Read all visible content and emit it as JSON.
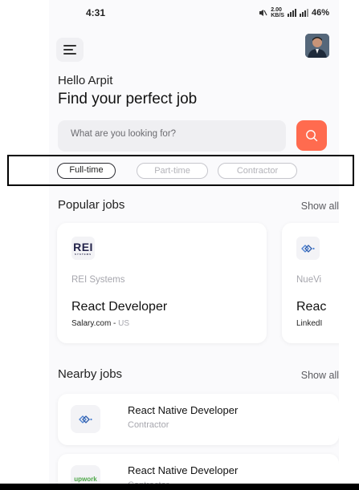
{
  "status_bar": {
    "time": "4:31",
    "net_speed_top": "2.00",
    "net_speed_bottom": "KB/S",
    "battery": "46%"
  },
  "header": {
    "greeting": "Hello Arpit",
    "headline": "Find your perfect job"
  },
  "search": {
    "placeholder": "What are you looking for?"
  },
  "filters": [
    {
      "label": "Full-time",
      "active": true
    },
    {
      "label": "Part-time",
      "active": false
    },
    {
      "label": "Contractor",
      "active": false
    }
  ],
  "popular": {
    "title": "Popular jobs",
    "show_all": "Show all",
    "cards": [
      {
        "company": "REI Systems",
        "title": "React Developer",
        "source": "Salary.com",
        "location": "US",
        "logo_text": "REI",
        "logo_sub": "SYSTEMS"
      },
      {
        "company": "NueVi",
        "title": "Reac",
        "source": "LinkedI",
        "location": ""
      }
    ]
  },
  "nearby": {
    "title": "Nearby jobs",
    "show_all": "Show all",
    "items": [
      {
        "title": "React Native Developer",
        "type": "Contractor"
      },
      {
        "title": "React Native Developer",
        "type": "Contractor",
        "logo_text": "upwork"
      }
    ]
  },
  "colors": {
    "accent": "#ff6b4f",
    "background": "#fafafc",
    "card": "#ffffff"
  }
}
